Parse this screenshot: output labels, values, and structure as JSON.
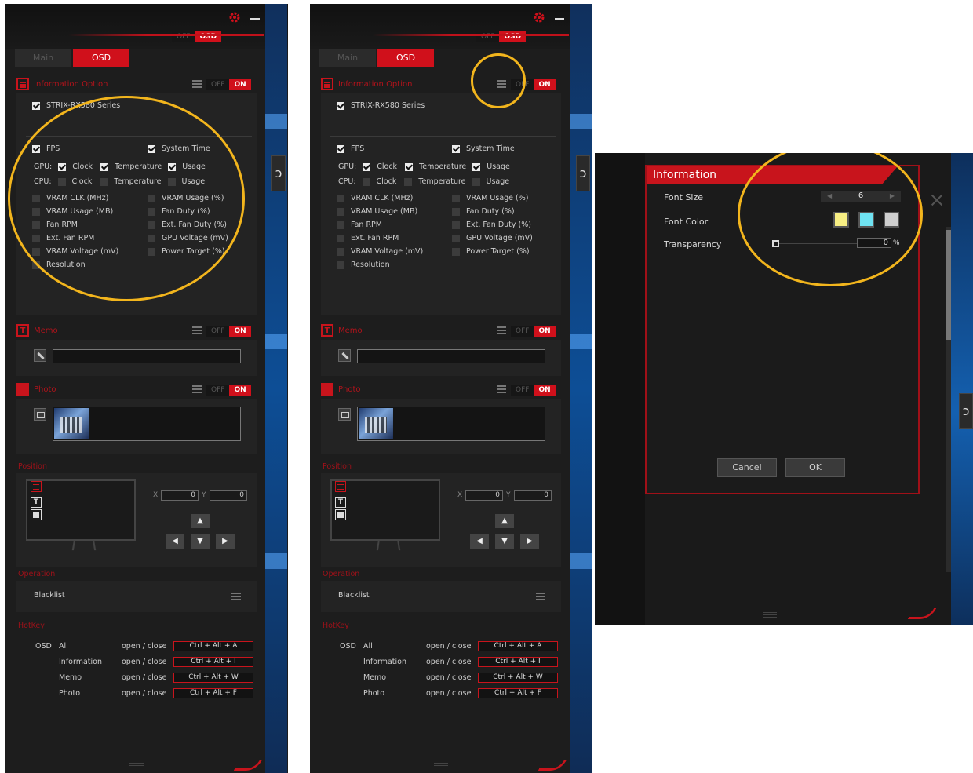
{
  "panel": {
    "tabs": {
      "main": "Main",
      "osd": "OSD"
    },
    "window_toggle": {
      "off": "OFF",
      "on": "OSD"
    },
    "section_toggle": {
      "off": "OFF",
      "on": "ON"
    },
    "information": {
      "title": "Information Option",
      "device": "STRIX-RX580 Series",
      "fps": "FPS",
      "system_time": "System Time",
      "gpu_label": "GPU:",
      "cpu_label": "CPU:",
      "clock": "Clock",
      "temperature": "Temperature",
      "usage": "Usage",
      "vram_clk": "VRAM CLK (MHz)",
      "vram_usage_pct": "VRAM Usage (%)",
      "vram_usage_mb": "VRAM Usage (MB)",
      "fan_duty": "Fan Duty (%)",
      "fan_rpm": "Fan RPM",
      "ext_fan_duty": "Ext. Fan Duty (%)",
      "ext_fan_rpm": "Ext. Fan RPM",
      "gpu_voltage": "GPU Voltage (mV)",
      "vram_voltage": "VRAM Voltage (mV)",
      "power_target": "Power Target (%)",
      "resolution": "Resolution"
    },
    "memo": {
      "title": "Memo"
    },
    "photo": {
      "title": "Photo"
    },
    "position": {
      "title": "Position",
      "x_label": "X",
      "y_label": "Y",
      "x_value": "0",
      "y_value": "0"
    },
    "operation": {
      "title": "Operation",
      "blacklist": "Blacklist"
    },
    "hotkey": {
      "title": "HotKey",
      "osd": "OSD",
      "rows": [
        {
          "name": "All",
          "action": "open / close",
          "key": "Ctrl + Alt + A"
        },
        {
          "name": "Information",
          "action": "open / close",
          "key": "Ctrl + Alt + I"
        },
        {
          "name": "Memo",
          "action": "open / close",
          "key": "Ctrl + Alt + W"
        },
        {
          "name": "Photo",
          "action": "open / close",
          "key": "Ctrl + Alt + F"
        }
      ]
    }
  },
  "dialog": {
    "title": "Information",
    "font_size_label": "Font Size",
    "font_size_value": "6",
    "font_color_label": "Font Color",
    "transparency_label": "Transparency",
    "transparency_value": "0",
    "transparency_unit": "%",
    "cancel": "Cancel",
    "ok": "OK",
    "swatches": [
      "#f7ee83",
      "#6fe3f2",
      "#cfcfcf"
    ]
  },
  "colors": {
    "accent": "#d0101b",
    "highlight_ring": "#f2b51d",
    "background": "#1d1d1d"
  }
}
